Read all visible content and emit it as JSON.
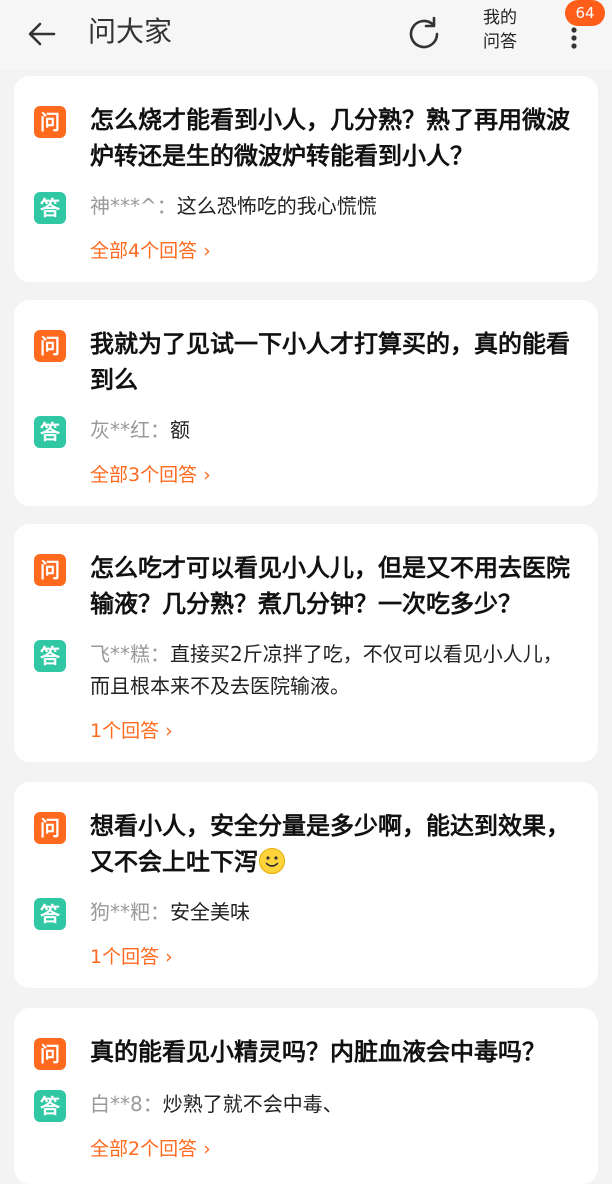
{
  "header": {
    "title": "问大家",
    "my_qa_line1": "我的",
    "my_qa_line2": "问答",
    "badge": "64"
  },
  "tags": {
    "question": "问",
    "answer": "答"
  },
  "cards": [
    {
      "question": "怎么烧才能看到小人，几分熟？熟了再用微波炉转还是生的微波炉转能看到小人？",
      "answer_user": "神***^：",
      "answer_text": "这么恐怖吃的我心慌慌",
      "more": "全部4个回答",
      "chevron": "›"
    },
    {
      "question": "我就为了见试一下小人才打算买的，真的能看到么",
      "answer_user": "灰**红：",
      "answer_text": "额",
      "more": "全部3个回答",
      "chevron": "›"
    },
    {
      "question": "怎么吃才可以看见小人儿，但是又不用去医院输液？几分熟？煮几分钟？一次吃多少？",
      "answer_user": "飞**糕：",
      "answer_text": "直接买2斤凉拌了吃，不仅可以看见小人儿，而且根本来不及去医院输液。",
      "more": "1个回答",
      "chevron": "›"
    },
    {
      "question": "想看小人，安全分量是多少啊，能达到效果，又不会上吐下泻",
      "emoji": "smiley-emoji-icon",
      "answer_user": "狗**粑：",
      "answer_text": "安全美味",
      "more": "1个回答",
      "chevron": "›"
    },
    {
      "question": "真的能看见小精灵吗？内脏血液会中毒吗？",
      "answer_user": "白**8：",
      "answer_text": "炒熟了就不会中毒、",
      "more": "全部2个回答",
      "chevron": "›"
    }
  ],
  "colors": {
    "accent": "#ff6a1f",
    "answer_tag": "#2fc7a4",
    "badge": "#ff5e1a",
    "background": "#f3f3f3"
  }
}
